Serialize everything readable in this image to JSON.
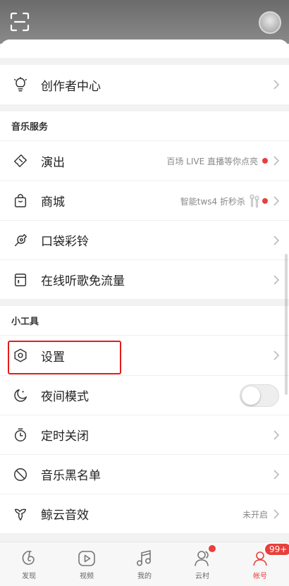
{
  "colors": {
    "accent": "#e8403c",
    "highlight": "#e31b1b"
  },
  "topbar": {
    "scan_icon": "scan-icon",
    "avatar": "avatar"
  },
  "creator": {
    "label": "创作者中心",
    "icon": "lightbulb-icon"
  },
  "music_services": {
    "title": "音乐服务",
    "items": [
      {
        "label": "演出",
        "icon": "ticket-icon",
        "hint": "百场 LIVE 直播等你点亮",
        "dot": true
      },
      {
        "label": "商城",
        "icon": "shopping-bag-icon",
        "hint": "智能tws4 折秒杀",
        "dot": true
      },
      {
        "label": "口袋彩铃",
        "icon": "ringtone-icon",
        "hint": "",
        "dot": false
      },
      {
        "label": "在线听歌免流量",
        "icon": "sim-card-icon",
        "hint": "",
        "dot": false
      }
    ]
  },
  "tools": {
    "title": "小工具",
    "items": [
      {
        "label": "设置",
        "icon": "settings-hexagon-icon",
        "hint": ""
      },
      {
        "label": "夜间模式",
        "icon": "moon-icon",
        "toggle": false
      },
      {
        "label": "定时关闭",
        "icon": "timer-icon",
        "hint": ""
      },
      {
        "label": "音乐黑名单",
        "icon": "block-icon",
        "hint": ""
      },
      {
        "label": "鲸云音效",
        "icon": "whale-icon",
        "hint": "未开启"
      }
    ]
  },
  "tabbar": {
    "tabs": [
      {
        "label": "发现",
        "icon": "netease-music-icon"
      },
      {
        "label": "视频",
        "icon": "play-icon"
      },
      {
        "label": "我的",
        "icon": "music-note-icon"
      },
      {
        "label": "云村",
        "icon": "people-icon",
        "dot": true
      },
      {
        "label": "帐号",
        "icon": "account-icon",
        "badge": "99+",
        "active": true
      }
    ]
  }
}
